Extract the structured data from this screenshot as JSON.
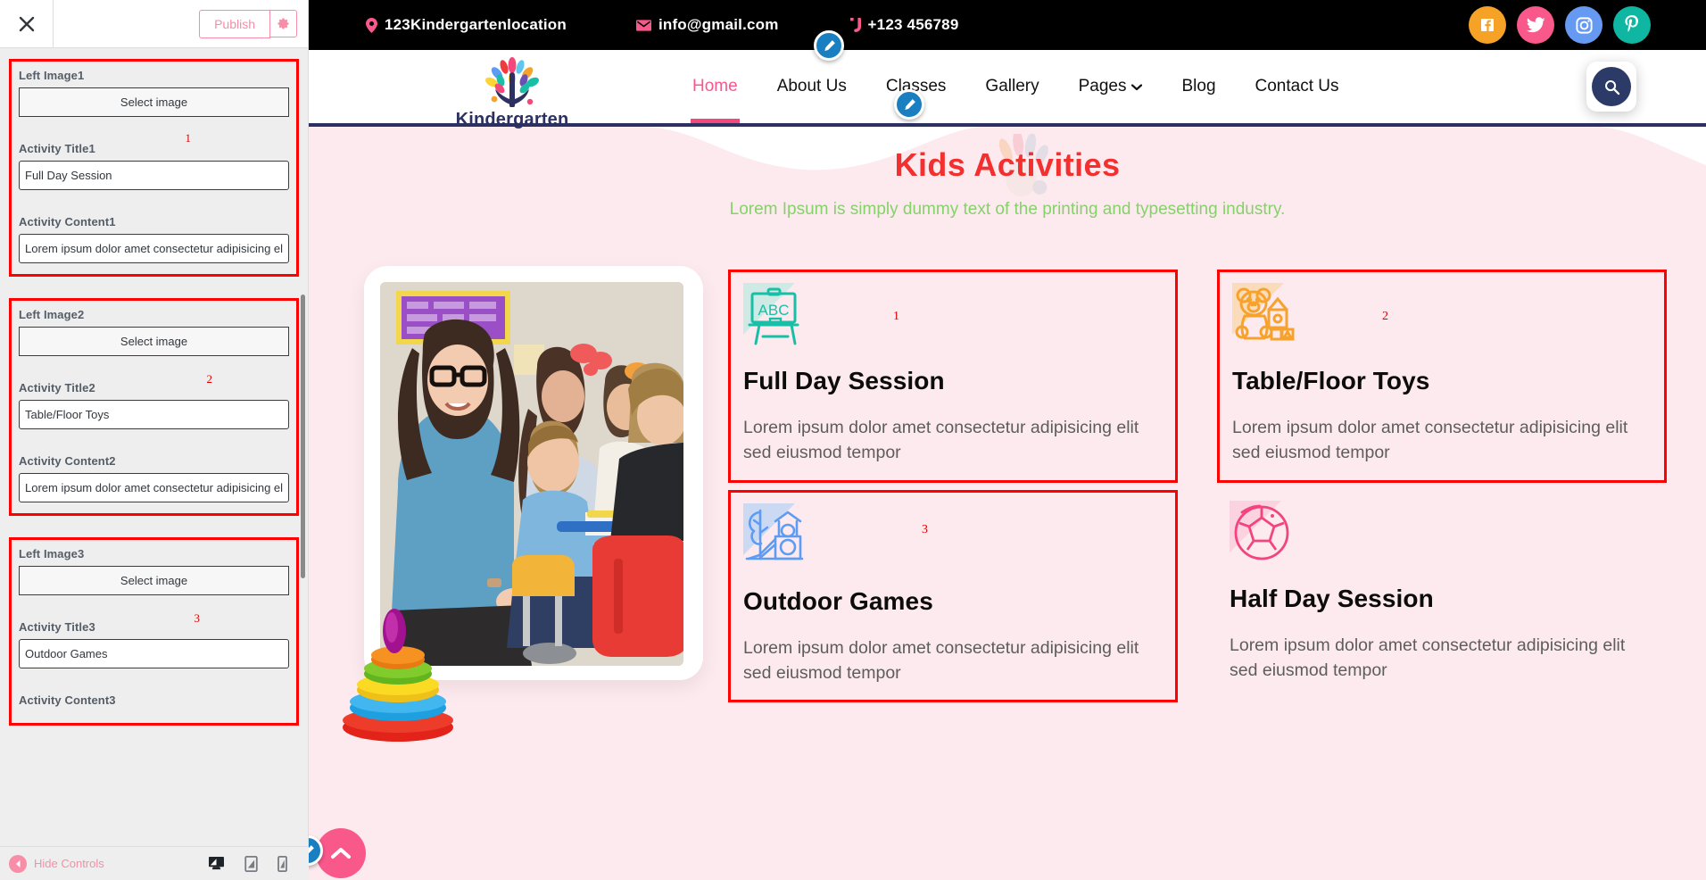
{
  "customizer": {
    "close_icon": "close-icon",
    "publish_label": "Publish",
    "gear_icon": "gear-icon",
    "hide_controls_label": "Hide Controls",
    "devices": [
      {
        "name": "desktop",
        "label": "Desktop",
        "active": true
      },
      {
        "name": "tablet",
        "label": "Tablet",
        "active": false
      },
      {
        "name": "mobile",
        "label": "Mobile",
        "active": false
      }
    ],
    "groups": [
      {
        "number": "1",
        "image_label": "Left Image1",
        "select_image_label": "Select image",
        "title_label": "Activity Title1",
        "title_value": "Full Day Session",
        "content_label": "Activity Content1",
        "content_value": "Lorem ipsum dolor amet consectetur adipisicing eli"
      },
      {
        "number": "2",
        "image_label": "Left Image2",
        "select_image_label": "Select image",
        "title_label": "Activity Title2",
        "title_value": "Table/Floor Toys",
        "content_label": "Activity Content2",
        "content_value": "Lorem ipsum dolor amet consectetur adipisicing eli"
      },
      {
        "number": "3",
        "image_label": "Left Image3",
        "select_image_label": "Select image",
        "title_label": "Activity Title3",
        "title_value": "Outdoor Games",
        "content_label": "Activity Content3",
        "content_value": ""
      }
    ]
  },
  "site": {
    "topbar": {
      "location": "123Kindergartenlocation",
      "email": "info@gmail.com",
      "phone": "+123 456789",
      "socials": [
        {
          "name": "facebook",
          "glyph": "f",
          "color": "#f5a227"
        },
        {
          "name": "twitter",
          "glyph": "t",
          "color": "#f9588b"
        },
        {
          "name": "instagram",
          "glyph": "i",
          "color": "#6699f2"
        },
        {
          "name": "pinterest",
          "glyph": "p",
          "color": "#0fb6a2"
        }
      ]
    },
    "brand": {
      "name": "Kindergarten"
    },
    "nav": [
      {
        "label": "Home",
        "active": true,
        "caret": false
      },
      {
        "label": "About Us",
        "active": false,
        "caret": false
      },
      {
        "label": "Classes",
        "active": false,
        "caret": false
      },
      {
        "label": "Gallery",
        "active": false,
        "caret": false
      },
      {
        "label": "Pages",
        "active": false,
        "caret": true
      },
      {
        "label": "Blog",
        "active": false,
        "caret": false
      },
      {
        "label": "Contact Us",
        "active": false,
        "caret": false
      }
    ],
    "search_icon": "search-icon",
    "section": {
      "title": "Kids Activities",
      "subtitle": "Lorem Ipsum is simply dummy text of the printing and typesetting industry.",
      "title_color": "#f2302f",
      "subtitle_color": "#86d16b",
      "background_color": "#fdeaee"
    },
    "cards": [
      {
        "number": "1",
        "icon": "abc-easel-icon",
        "icon_color": "#18bfa6",
        "icon_bg": "#cfe9e5",
        "title": "Full Day Session",
        "text": "Lorem ipsum dolor amet consectetur adipisicing elit sed eiusmod tempor",
        "boxed": true
      },
      {
        "number": "2",
        "icon": "teddy-bear-icon",
        "icon_color": "#f7a22c",
        "icon_bg": "#fbdcba",
        "title": "Table/Floor Toys",
        "text": "Lorem ipsum dolor amet consectetur adipisicing elit sed eiusmod tempor",
        "boxed": true
      },
      {
        "number": "3",
        "icon": "playground-slide-icon",
        "icon_color": "#5c9cf5",
        "icon_bg": "#ccd9f2",
        "title": "Outdoor Games",
        "text": "Lorem ipsum dolor amet consectetur adipisicing elit sed eiusmod tempor",
        "boxed": true
      },
      {
        "number": "",
        "icon": "soccer-ball-icon",
        "icon_color": "#f2457f",
        "icon_bg": "#fbd2e0",
        "title": "Half Day Session",
        "text": "Lorem ipsum dolor amet consectetur adipisicing elit sed eiusmod tempor",
        "boxed": false
      }
    ],
    "scroll_top_icon": "chevron-up-icon"
  }
}
